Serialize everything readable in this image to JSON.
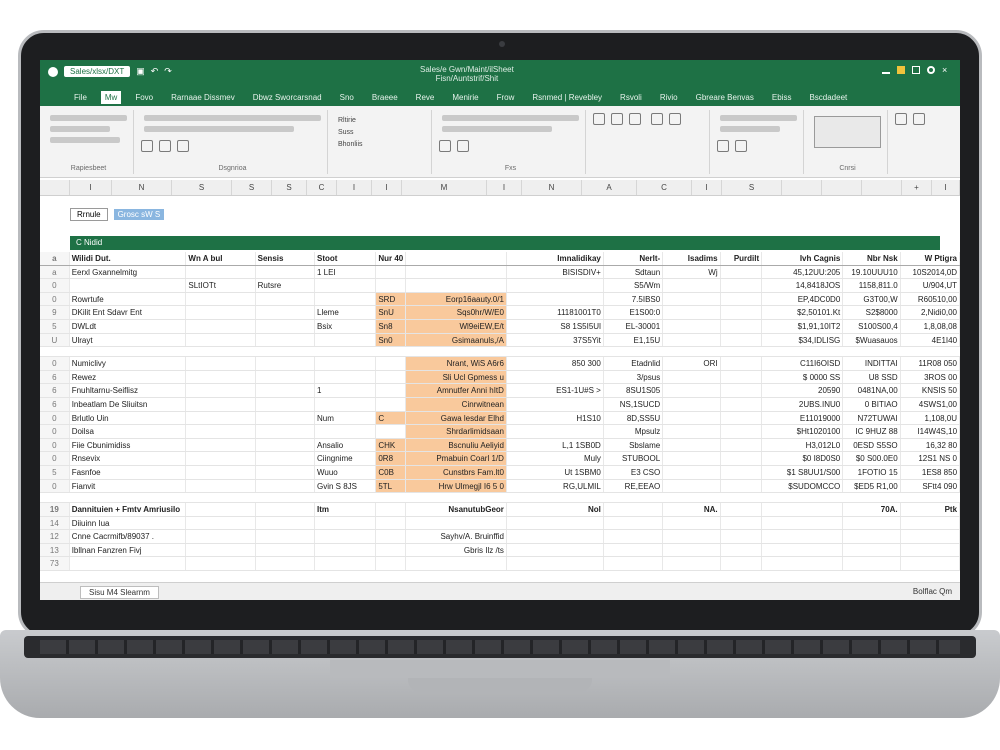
{
  "titlebar": {
    "file_label": "Sales/xlsx/DXT",
    "center_line1": "Sales/e   Gwn/Maint/ilSheet",
    "center_line2": "Fisn/Auntstrif/Shit"
  },
  "tabs": [
    "File",
    "Mw",
    "Fovo",
    "Rarnaae Dissmev",
    "Dbwz Sworcarsnad",
    "Sno",
    "Braeee",
    "Reve",
    "Menirie",
    "Frow",
    "Rsnmed | Revebley",
    "Rsvoli",
    "Rivio",
    "Gbreare Benvas",
    "Ebiss",
    "Bscdadeet"
  ],
  "ribbon": {
    "groups": [
      "Rapiesbeet",
      "Dsgnrioa",
      "",
      "Fxs",
      "",
      "",
      "Cnrsi",
      ""
    ],
    "row_labels": [
      "Rltirie",
      "Suss",
      "Bhonliis"
    ]
  },
  "column_headers": [
    "",
    "I",
    "N",
    "S",
    "S",
    "S",
    "C",
    "I",
    "I",
    "M",
    "I",
    "N",
    "A",
    "C",
    "I",
    "S",
    "",
    "",
    "",
    "+",
    "I"
  ],
  "namebar": {
    "name_box": "Rrnule",
    "selected": "Grosc sW S"
  },
  "band_title": "C Nidid",
  "header_row": {
    "rn": "a",
    "cells": [
      "Wilidi Dut.",
      "Wn A bul",
      "Sensis",
      "Stoot",
      "Nur 40",
      "",
      "Imnalidikay",
      "Nerlt-",
      "Isadims",
      "Purdilt",
      "Ivh Cagnis",
      "Nbr Nsk",
      "W Ptigra"
    ]
  },
  "rows": [
    {
      "rn": "a",
      "cells": [
        "Eerxl Gxannelmitg",
        "",
        "",
        "1 LEI",
        "",
        "",
        "BISISDIV+",
        "Sdtaun",
        "Wj",
        "",
        "45,12UU:205",
        "19.10UUU10",
        "10S2014,0D"
      ]
    },
    {
      "rn": "0",
      "cells": [
        "",
        "SLtIOTt",
        "Rutsre",
        "",
        "",
        "",
        "",
        "S5/Wm",
        "",
        "",
        "14,8418JOS",
        "1158,811.0",
        "U/904,UT"
      ]
    },
    {
      "rn": "0",
      "cells": [
        "Rowrtufe",
        "",
        "",
        "",
        "SRD",
        "Eorp16aauty.0/1",
        "",
        "7.5IBS0",
        "",
        "",
        "EP,4DC0D0",
        "G3T00,W",
        "R60510,00"
      ]
    },
    {
      "rn": "9",
      "cells": [
        "DKilit Ent Sdavr Ent",
        "",
        "",
        "Lleme",
        "SnU",
        "Sqs0hr/W/E0",
        "11181001T0",
        "E1S00:0",
        "",
        "",
        "$2,50101.Kt",
        "S2$8000",
        "2,Nidi0,00"
      ]
    },
    {
      "rn": "5",
      "cells": [
        "DWLdt",
        "",
        "",
        "Bsix",
        "Sn8",
        "Wl9eiEW,E/t",
        "S8 1S5I5Ul",
        "EL-30001",
        "",
        "",
        "$1,91,10IT2",
        "S100S00,4",
        "1,8,08,08"
      ]
    },
    {
      "rn": "U",
      "cells": [
        "Ulrayt",
        "",
        "",
        "",
        "Sn0",
        "Gsimaanuls,/A",
        "37S5Yit",
        "E1,15U",
        "",
        "",
        "$34,IDLISG",
        "$Wuasauos",
        "4E1I40"
      ]
    }
  ],
  "rows2": [
    {
      "rn": "0",
      "cells": [
        "Numiclivy",
        "",
        "",
        "",
        "",
        "Nrant, WiS A6r6",
        "850 300",
        "Etadnlid",
        "ORI",
        "",
        "C11I6OISD",
        "INDITTAI",
        "11R08 050"
      ]
    },
    {
      "rn": "6",
      "cells": [
        "Rewez",
        "",
        "",
        "",
        "",
        "Sli Ucl Gpmess u",
        "",
        "3/psus",
        "",
        "",
        "$ 0000 SS",
        "U8 SSD",
        "3ROS 00"
      ]
    },
    {
      "rn": "6",
      "cells": [
        "Fnuhltarnu-Seiflisz",
        "",
        "",
        "1",
        "",
        "Amnutfer Anni hItD",
        "ES1-1U#S >",
        "8SU1S05",
        "",
        "",
        "20590",
        "0481NA,00",
        "KNSIS 50"
      ]
    },
    {
      "rn": "6",
      "cells": [
        "Inbeatlam De Sliuitsn",
        "",
        "",
        "",
        "",
        "Cinrwitnean",
        "",
        "NS,1SUCD",
        "",
        "",
        "2UBS.INU0",
        "0 BITIAO",
        "4SWS1,00"
      ]
    },
    {
      "rn": "0",
      "cells": [
        "Brlutlo Uin",
        "",
        "",
        "Num",
        "C",
        "Gawa lesdar Elhd",
        "H1S10",
        "8D,SS5U",
        "",
        "",
        "E11019000",
        "N72TUWAI",
        "1,108,0U"
      ]
    },
    {
      "rn": "0",
      "cells": [
        "Doilsa",
        "",
        "",
        "",
        "",
        "Shrdarlimidsaan",
        "",
        "Mpsulz",
        "",
        "",
        "$Ht1020100",
        "IC 9HUZ 88",
        "I14W4S,10"
      ]
    },
    {
      "rn": "0",
      "cells": [
        "Fiie Cbunimidiss",
        "",
        "",
        "Ansalio",
        "CHK",
        "Bscnuliu Aeliyid",
        "L,1 1SB0D",
        "Sbslame",
        "",
        "",
        "H3,012L0",
        "0ESD S5SO",
        "16,32 80"
      ]
    },
    {
      "rn": "0",
      "cells": [
        "Rnsevix",
        "",
        "",
        "Ciingnime",
        "0R8",
        "Pmabuin Coarl 1/D",
        "Muly",
        "STUBOOL",
        "",
        "",
        "$0 I8D0S0",
        "$0 S00.0E0",
        "12S1 NS 0"
      ]
    },
    {
      "rn": "5",
      "cells": [
        "Fasnfoe",
        "",
        "",
        "Wuuo",
        "C0B",
        "Cunstbrs Fam.lt0",
        "Ut 1SBM0",
        "E3 CSO",
        "",
        "",
        "$1 S8UU1/S00",
        "1FOTIO 15",
        "1ES8 850"
      ]
    },
    {
      "rn": "0",
      "cells": [
        "Fianvit",
        "",
        "",
        "Gvin S 8JS",
        "5TL",
        "Hrw Ulmegjl I6 5 0",
        "RG,ULMIL",
        "RE,EEAO",
        "",
        "",
        "$SUDOMCCO",
        "$ED5 R1,00",
        "SFtt4 090"
      ]
    }
  ],
  "summary_rows": [
    {
      "rn": "19",
      "cells": [
        "Dannituien + Fmtv Amriusilo",
        "",
        "",
        "Itm",
        "",
        "NsanutubGeor",
        "Nol",
        "",
        "NA.",
        "",
        "",
        "70A.",
        "Ptk"
      ]
    },
    {
      "rn": "14",
      "cells": [
        "Diiuinn Iua",
        "",
        "",
        "",
        "",
        "",
        "",
        "",
        "",
        "",
        "",
        "",
        ""
      ]
    },
    {
      "rn": "12",
      "cells": [
        "Cnne Cacrmifb/89037 .",
        "",
        "",
        "",
        "",
        "Sayhv/A. Bruinffid",
        "",
        "",
        "",
        "",
        "",
        "",
        ""
      ]
    },
    {
      "rn": "13",
      "cells": [
        "Ibllnan Fanzren Fivj",
        "",
        "",
        "",
        "",
        "Gbris Ilz /ts",
        "",
        "",
        "",
        "",
        "",
        "",
        ""
      ]
    },
    {
      "rn": "73",
      "cells": [
        "",
        "",
        "",
        "",
        "",
        "",
        "",
        "",
        "",
        "",
        "",
        "",
        ""
      ]
    }
  ],
  "statusbar": {
    "sheet": "Sisu M4 Slearnm",
    "right": "Bolflac Qm"
  },
  "colors": {
    "excel_green": "#1e7145",
    "highlight": "#f9c99c"
  }
}
